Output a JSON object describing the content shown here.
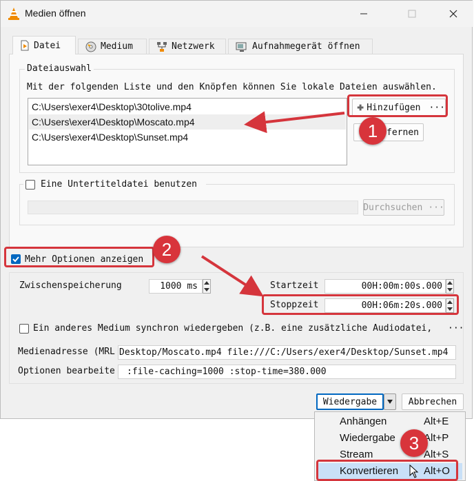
{
  "window": {
    "title": "Medien öffnen",
    "app_icon": "vlc-cone-icon"
  },
  "tabs": [
    {
      "label": "Datei",
      "icon": "file-icon",
      "active": true
    },
    {
      "label": "Medium",
      "icon": "disc-icon"
    },
    {
      "label": "Netzwerk",
      "icon": "network-icon"
    },
    {
      "label": "Aufnahmegerät öffnen",
      "icon": "capture-device-icon"
    }
  ],
  "file_selection": {
    "legend": "Dateiauswahl",
    "description": "Mit der folgenden Liste und den Knöpfen können Sie lokale Dateien auswählen.",
    "files": [
      "C:\\Users\\exer4\\Desktop\\30tolive.mp4",
      "C:\\Users\\exer4\\Desktop\\Moscato.mp4",
      "C:\\Users\\exer4\\Desktop\\Sunset.mp4"
    ],
    "selected_index": 1,
    "add_button": "Hinzufügen",
    "add_more": "···",
    "remove_button_visible": "fernen"
  },
  "subtitles": {
    "checkbox_label": "Eine Untertiteldatei benutzen",
    "checked": false,
    "browse_button": "Durchsuchen",
    "browse_more": "···"
  },
  "more_options": {
    "label": "Mehr Optionen anzeigen",
    "checked": true
  },
  "options": {
    "caching_label": "Zwischenspeicherung",
    "caching_value": "1000 ms",
    "start_label": "Startzeit",
    "start_value": "00H:00m:00s.000",
    "stop_label": "Stoppzeit",
    "stop_value": "00H:06m:20s.000",
    "sync_label": "Ein anderes Medium synchron wiedergeben (z.B. eine zusätzliche Audiodatei,",
    "sync_more": "···",
    "mrl_label": "Medienadresse (MRL",
    "mrl_value": "Desktop/Moscato.mp4 file:///C:/Users/exer4/Desktop/Sunset.mp4",
    "edit_label": "Optionen bearbeite",
    "edit_value": ":file-caching=1000 :stop-time=380.000"
  },
  "footer": {
    "play_button": "Wiedergabe",
    "cancel_button": "Abbrechen"
  },
  "dropdown_menu": [
    {
      "label": "Anhängen",
      "shortcut": "Alt+E"
    },
    {
      "label": "Wiedergabe",
      "shortcut": "Alt+P"
    },
    {
      "label": "Stream",
      "shortcut": "Alt+S"
    },
    {
      "label": "Konvertieren",
      "shortcut": "Alt+O",
      "highlighted": true
    }
  ],
  "annotations": {
    "badge_1": "1",
    "badge_2": "2",
    "badge_3": "3",
    "accent_color": "#d5353c"
  }
}
